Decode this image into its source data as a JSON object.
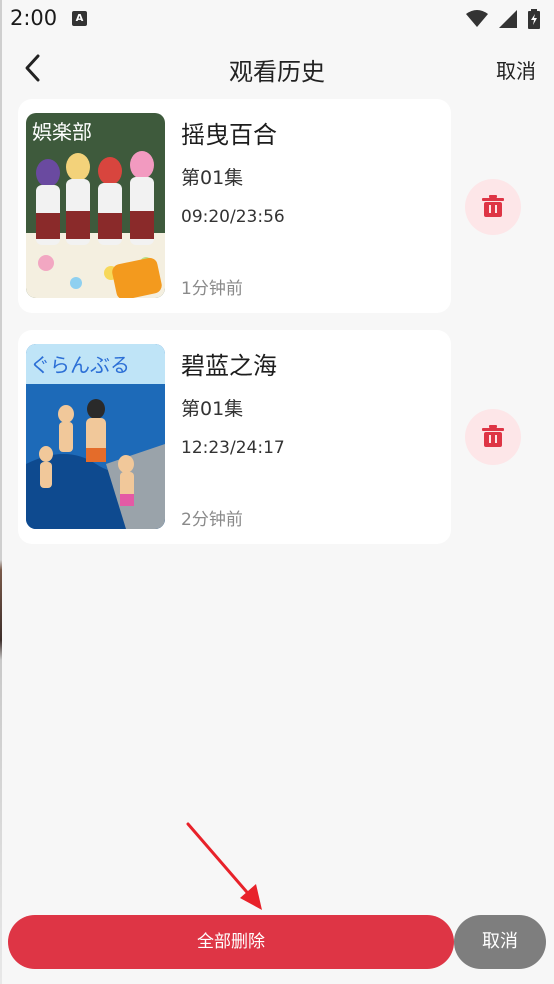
{
  "status_bar": {
    "time": "2:00",
    "notification_icon_letter": "A",
    "icons": [
      "wifi-icon",
      "signal-icon",
      "battery-charging-icon"
    ]
  },
  "header": {
    "title": "观看历史",
    "cancel_label": "取消",
    "back_icon": "chevron-left-icon"
  },
  "history": [
    {
      "title": "摇曳百合",
      "episode": "第01集",
      "progress": "09:20/23:56",
      "time_ago": "1分钟前",
      "poster_text": "娯楽部"
    },
    {
      "title": "碧蓝之海",
      "episode": "第01集",
      "progress": "12:23/24:17",
      "time_ago": "2分钟前",
      "poster_text": "ぐらんぶる"
    }
  ],
  "bottom": {
    "delete_all_label": "全部删除",
    "cancel_label": "取消"
  },
  "colors": {
    "accent": "#de3545",
    "delete_bg": "#fde6e8",
    "cancel_bg": "#7e7e7e",
    "annotation_arrow": "#e8222a"
  }
}
